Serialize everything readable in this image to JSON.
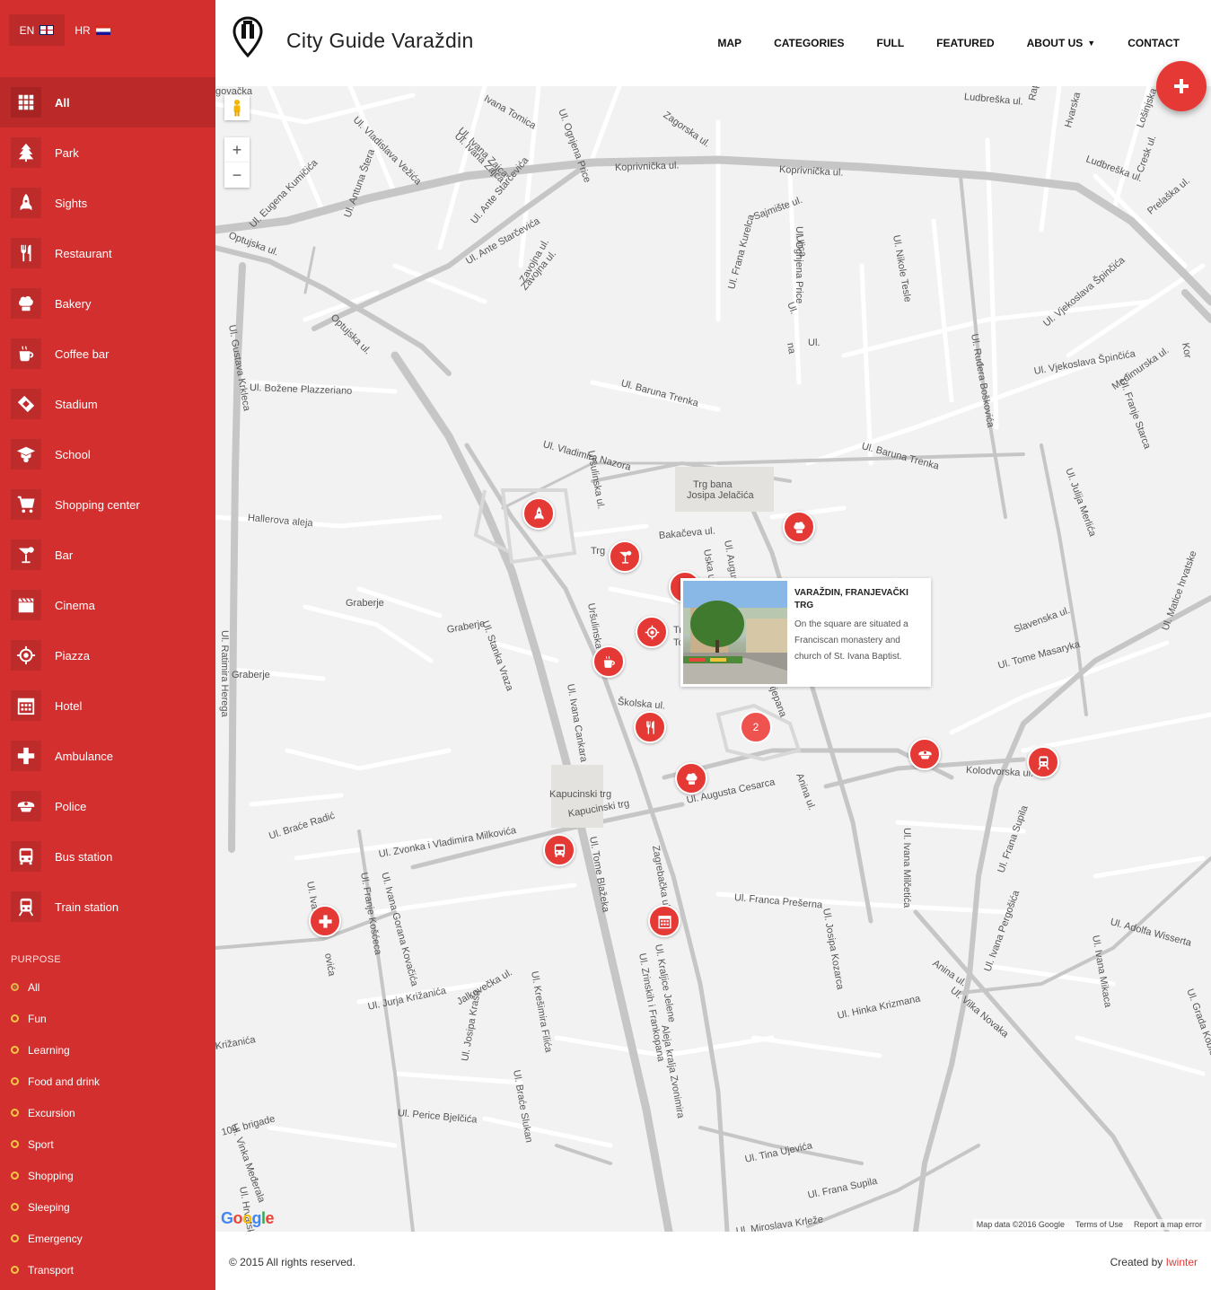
{
  "languages": [
    {
      "code": "EN",
      "flag": "uk-flag",
      "active": true
    },
    {
      "code": "HR",
      "flag": "hr-flag",
      "active": false
    }
  ],
  "categories": [
    {
      "label": "All",
      "icon": "grid-icon"
    },
    {
      "label": "Park",
      "icon": "tree-icon"
    },
    {
      "label": "Sights",
      "icon": "rocket-icon"
    },
    {
      "label": "Restaurant",
      "icon": "fork-knife-icon"
    },
    {
      "label": "Bakery",
      "icon": "chef-hat-icon"
    },
    {
      "label": "Coffee bar",
      "icon": "coffee-icon"
    },
    {
      "label": "Stadium",
      "icon": "ticket-icon"
    },
    {
      "label": "School",
      "icon": "graduate-icon"
    },
    {
      "label": "Shopping center",
      "icon": "cart-icon"
    },
    {
      "label": "Bar",
      "icon": "cocktail-icon"
    },
    {
      "label": "Cinema",
      "icon": "clapper-icon"
    },
    {
      "label": "Piazza",
      "icon": "target-icon"
    },
    {
      "label": "Hotel",
      "icon": "calendar-icon"
    },
    {
      "label": "Ambulance",
      "icon": "cross-icon"
    },
    {
      "label": "Police",
      "icon": "police-cap-icon"
    },
    {
      "label": "Bus station",
      "icon": "bus-icon"
    },
    {
      "label": "Train station",
      "icon": "train-icon"
    }
  ],
  "purpose": {
    "title": "PURPOSE",
    "items": [
      "All",
      "Fun",
      "Learning",
      "Food and drink",
      "Excursion",
      "Sport",
      "Shopping",
      "Sleeping",
      "Emergency",
      "Transport"
    ]
  },
  "header": {
    "title": "City Guide Varaždin",
    "nav": [
      {
        "label": "MAP",
        "dropdown": false
      },
      {
        "label": "CATEGORIES",
        "dropdown": false
      },
      {
        "label": "FULL",
        "dropdown": false
      },
      {
        "label": "FEATURED",
        "dropdown": false
      },
      {
        "label": "ABOUT US",
        "dropdown": true
      },
      {
        "label": "CONTACT",
        "dropdown": false
      }
    ]
  },
  "map": {
    "zoom_in": "+",
    "zoom_out": "−",
    "streets": [
      "Koprivnička ul.",
      "Koprivnička ul.",
      "Ul. Ante Starčevića",
      "Optujska ul.",
      "Optujska ul.",
      "Ul. Gustava Krkleca",
      "Ul. Božene Plazzeriano",
      "Ul. Baruna Trenka",
      "Ul. Vladimira Nazora",
      "Ul. Vjekoslava Špinčića",
      "Ul. Baruna Trenka",
      "Hallerova aleja",
      "Graberje",
      "Graberje",
      "Graberje",
      "Ul. Ratimira Herega",
      "Ul. Stanka Vraza",
      "Trg bana",
      "Josipa Jelačića",
      "Bakačeva ul.",
      "Školska ul.",
      "Ul. Ivana Cankara",
      "Kapucinski trg",
      "Kapucinski trg",
      "Ul. Augusta Cesarca",
      "Zagrebačka ul.",
      "Ul. Braće Radić",
      "Ul. Zvonka i Vladimira Milkovića",
      "Ul. Franca Prešerna",
      "Kolodvorska ul.",
      "Ul. Frana Supila",
      "Ul. Ivana Milčetića",
      "Ul. Jurja Križanića",
      "Jalkovečka ul.",
      "Ul. Zrinskih i Frankopana",
      "Ul. Hinka Krizmana",
      "Ul. Vilka Novaka",
      "Ul. Tina Ujevića",
      "Ul. Frana Supila",
      "Ul. Miroslava Krleže",
      "Međimurska ul.",
      "Ul. Julija Merlića",
      "Ul. Ruđera Boškovića",
      "Ul. Adolfa Wisserta",
      "Ludbreška ul.",
      "Ul. Ivana Zajca",
      "Zavojna ul.",
      "Sajmište ul.",
      "Ul. Nikole Tesle",
      "Ul. Ognjena Price",
      "Ul. Frana Kurelca",
      "Ul. Eugena Kumičića",
      "Ul. Antuna Štera",
      "Ul. Vladislava Vežića",
      "Ul. Ivana Gorana Kovačića",
      "Ul. Franje Košćeca",
      "Ul. Krešimira Filića",
      "Ul. Perice Bjelčića",
      "104. brigade",
      "Ul. Vinka Međerala",
      "Ul. Hrvatskih",
      "Ul. Braće Slukan",
      "Ul. Josipa Kraša",
      "Ul. Tome Blažeka",
      "Ul. Josipa Kozarca",
      "Ul. Ivana Pergošića",
      "Ul. Ivana Mikaca",
      "Ul. Franje Starca",
      "Ul. Matice hrvatske",
      "Ul. Grada Koblenza",
      "Slavenska ul.",
      "Ul. Tome Masaryka",
      "Anina ul.",
      "Anina ul.",
      "Ul. Kraljice Jelene",
      "Aleja kralja Zvonimira",
      "Uršulinska ul.",
      "Uršulinska ul.",
      "Uska ul.",
      "Ul. Augusta Šenoe",
      "Ul. Stjepana",
      "Trg",
      "Trg",
      "To",
      "Križanića",
      "Ul. Ivan",
      "ovića",
      "Ul. Vjekoslava Špinčića",
      "Lošinjska ul.",
      "Cresk ul.",
      "Ludbreška ul.",
      "Prelaška ul.",
      "Ul. Ivana Zajca",
      "Zavojna ul.",
      "Ul. Ante Starčevića",
      "Zagorska ul.",
      "Rapska",
      "Hvarska",
      "Kor",
      "Ul.",
      "na",
      "Ul.",
      "Ulica",
      "Ul. Ognjena Price",
      "Ivana Tomica",
      "govačka"
    ],
    "markers": [
      {
        "icon": "rocket-icon"
      },
      {
        "icon": "cocktail-icon"
      },
      {
        "icon": "chef-hat-icon"
      },
      {
        "icon": "target-icon"
      },
      {
        "icon": "coffee-icon"
      },
      {
        "icon": "fork-knife-icon"
      },
      {
        "icon": "chef-hat-icon"
      },
      {
        "icon": "police-cap-icon"
      },
      {
        "icon": "train-icon"
      },
      {
        "icon": "bus-icon"
      },
      {
        "icon": "calendar-icon"
      },
      {
        "icon": "cross-icon"
      }
    ],
    "cluster_count": "2",
    "info": {
      "title": "VARAŽDIN, FRANJEVAČKI TRG",
      "text": "On the square are situated a Franciscan monastery and church of St. Ivana Baptist."
    },
    "google": [
      "G",
      "o",
      "o",
      "g",
      "l",
      "e"
    ],
    "attribution": [
      "Map data ©2016 Google",
      "Terms of Use",
      "Report a map error"
    ]
  },
  "footer": {
    "copyright": "© 2015 All rights reserved.",
    "created_by": "Created by",
    "brand": "Iwinter"
  },
  "colors": {
    "primary": "#d32f2f",
    "accent": "#e53935",
    "map_bg": "#f2f2f2",
    "road": "#c6c6c6"
  }
}
